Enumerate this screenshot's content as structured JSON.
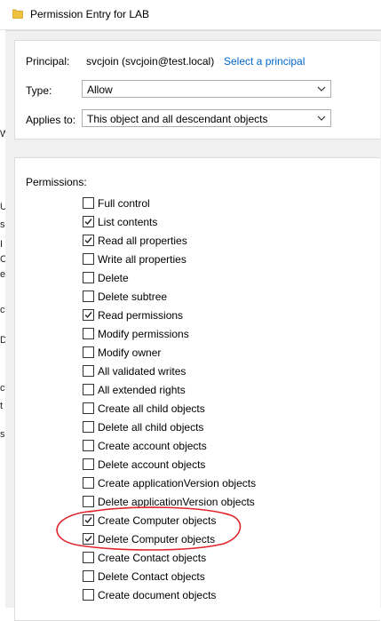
{
  "window": {
    "title": "Permission Entry for LAB",
    "icon": "folder-icon"
  },
  "background_window": {
    "fragments": [
      "W",
      "U",
      "s",
      "I",
      "C",
      "e",
      "c",
      "D",
      "c",
      "t",
      "s"
    ]
  },
  "principal": {
    "label": "Principal:",
    "value": "svcjoin (svcjoin@test.local)",
    "link": "Select a principal"
  },
  "type": {
    "label": "Type:",
    "value": "Allow"
  },
  "applies_to": {
    "label": "Applies to:",
    "value": "This object and all descendant objects"
  },
  "permissions": {
    "label": "Permissions:",
    "items": [
      {
        "label": "Full control",
        "checked": false
      },
      {
        "label": "List contents",
        "checked": true
      },
      {
        "label": "Read all properties",
        "checked": true
      },
      {
        "label": "Write all properties",
        "checked": false
      },
      {
        "label": "Delete",
        "checked": false
      },
      {
        "label": "Delete subtree",
        "checked": false
      },
      {
        "label": "Read permissions",
        "checked": true
      },
      {
        "label": "Modify permissions",
        "checked": false
      },
      {
        "label": "Modify owner",
        "checked": false
      },
      {
        "label": "All validated writes",
        "checked": false
      },
      {
        "label": "All extended rights",
        "checked": false
      },
      {
        "label": "Create all child objects",
        "checked": false
      },
      {
        "label": "Delete all child objects",
        "checked": false
      },
      {
        "label": "Create account objects",
        "checked": false
      },
      {
        "label": "Delete account objects",
        "checked": false
      },
      {
        "label": "Create applicationVersion objects",
        "checked": false
      },
      {
        "label": "Delete applicationVersion objects",
        "checked": false
      },
      {
        "label": "Create Computer objects",
        "checked": true
      },
      {
        "label": "Delete Computer objects",
        "checked": true
      },
      {
        "label": "Create Contact objects",
        "checked": false
      },
      {
        "label": "Delete Contact objects",
        "checked": false
      },
      {
        "label": "Create document objects",
        "checked": false
      }
    ]
  },
  "colors": {
    "annotation": "#e0242b",
    "link": "#0066cc"
  }
}
